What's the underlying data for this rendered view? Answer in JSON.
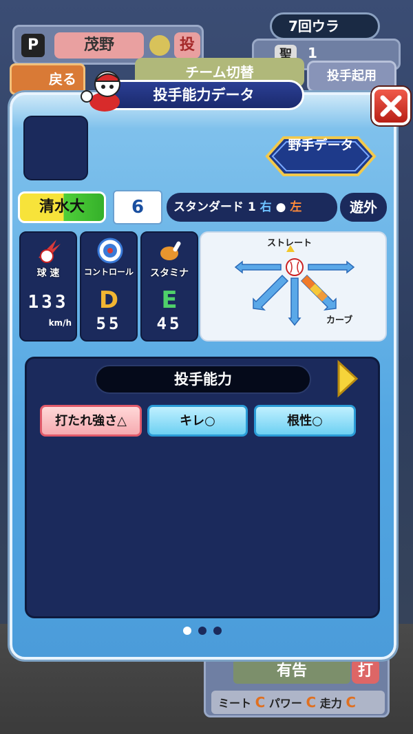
{
  "background_hud": {
    "position_label": "P",
    "player_name": "茂野",
    "position_kanji": "投",
    "inning": "7回ウラ",
    "base_label": "聖",
    "base_count": "1",
    "back_button": "戻る",
    "team_switch_button": "チーム切替",
    "pitcher_button": "投手起用",
    "bottom_result": "有告",
    "bottom_uchi": "打",
    "meet_label": "ミート",
    "meet_grade": "C",
    "power_label": "パワー",
    "power_grade": "C",
    "run_label": "走力",
    "run_grade": "C"
  },
  "panel": {
    "title": "投手能力データ",
    "fielder_data_button": "野手データ",
    "school": "清水大",
    "number": "6",
    "form_label": "スタンダード 1",
    "throw_right": "右",
    "bat_left": "左",
    "sub_position": "遊外"
  },
  "stats": {
    "speed": {
      "label": "球 速",
      "value": "133",
      "unit": "km/h"
    },
    "control": {
      "label": "コントロール",
      "grade": "D",
      "value": "55"
    },
    "stamina": {
      "label": "スタミナ",
      "grade": "E",
      "value": "45"
    }
  },
  "pitch_chart": {
    "straight_label": "ストレート",
    "curve_label": "カーブ",
    "curve_level": 3
  },
  "ability": {
    "title": "投手能力",
    "skills": [
      {
        "label": "打たれ強さ△",
        "style": "red"
      },
      {
        "label": "キレ○",
        "style": "blue"
      },
      {
        "label": "根性○",
        "style": "blue"
      }
    ],
    "page_count": 3,
    "current_page": 1
  },
  "colors": {
    "grade_D": "#f2b632",
    "grade_E": "#4fd16a",
    "title_bar": "#1b2a6e"
  }
}
